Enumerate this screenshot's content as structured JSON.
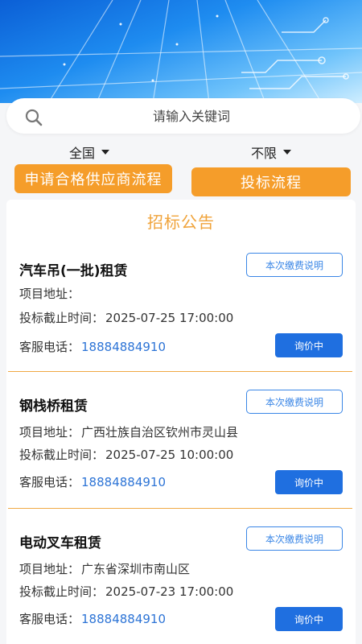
{
  "search": {
    "placeholder": "请输入关键词"
  },
  "filters": {
    "region": "全国",
    "limit": "不限"
  },
  "buttons": {
    "apply_supplier": "申请合格供应商流程",
    "bid_process": "投标流程"
  },
  "section_title": "招标公告",
  "labels": {
    "address": "项目地址：",
    "deadline": "投标截止时间：",
    "phone": "客服电话：",
    "fee": "本次缴费说明",
    "inquiry": "询价中"
  },
  "notices": [
    {
      "title": "汽车吊(一批)租赁",
      "address": "",
      "deadline": "2025-07-25 17:00:00",
      "phone": "18884884910"
    },
    {
      "title": "钢栈桥租赁",
      "address": "广西壮族自治区钦州市灵山县",
      "deadline": "2025-07-25 10:00:00",
      "phone": "18884884910"
    },
    {
      "title": "电动叉车租赁",
      "address": "广东省深圳市南山区",
      "deadline": "2025-07-23 17:00:00",
      "phone": "18884884910"
    }
  ],
  "colors": {
    "accent_orange": "#f59d2a",
    "primary_blue": "#1f6fe0",
    "title_orange": "#f0a33a",
    "link_blue": "#2d74d6"
  }
}
